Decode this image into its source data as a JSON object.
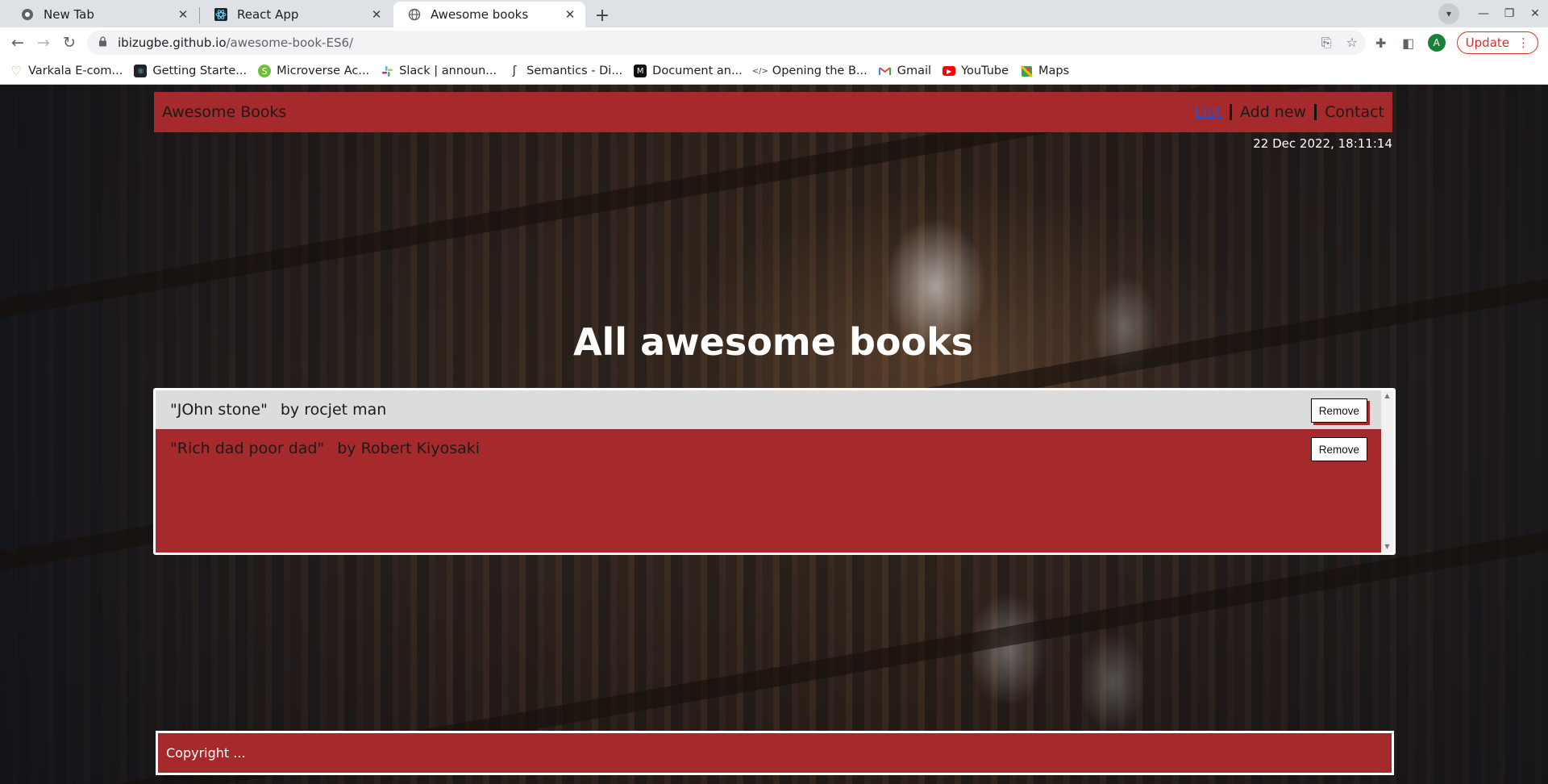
{
  "browser": {
    "tabs": [
      {
        "title": "New Tab",
        "icon": "chrome-icon"
      },
      {
        "title": "React App",
        "icon": "react-icon"
      },
      {
        "title": "Awesome books",
        "icon": "globe-icon",
        "active": true
      }
    ],
    "url_host": "ibizugbe.github.io",
    "url_path": "/awesome-book-ES6/",
    "update_label": "Update",
    "avatar_letter": "A",
    "bookmarks": [
      {
        "label": "Varkala E-com...",
        "icon": "heart-icon"
      },
      {
        "label": "Getting Starte...",
        "icon": "react-icon"
      },
      {
        "label": "Microverse Ac...",
        "icon": "microverse-icon"
      },
      {
        "label": "Slack | announ...",
        "icon": "slack-icon"
      },
      {
        "label": "Semantics - Di...",
        "icon": "semantics-icon"
      },
      {
        "label": "Document an...",
        "icon": "medium-icon"
      },
      {
        "label": "Opening the B...",
        "icon": "code-icon"
      },
      {
        "label": "Gmail",
        "icon": "gmail-icon"
      },
      {
        "label": "YouTube",
        "icon": "youtube-icon"
      },
      {
        "label": "Maps",
        "icon": "maps-icon"
      }
    ]
  },
  "site": {
    "brand": "Awesome Books",
    "nav": {
      "list": "List",
      "add_new": "Add new",
      "contact": "Contact"
    },
    "datetime": "22 Dec 2022, 18:11:14",
    "heading": "All awesome books",
    "books": [
      {
        "title": "\"JOhn stone\"",
        "author": "by rocjet man",
        "remove_label": "Remove"
      },
      {
        "title": "\"Rich dad poor dad\"",
        "author": "by Robert Kiyosaki",
        "remove_label": "Remove"
      }
    ],
    "footer": "Copyright ..."
  },
  "colors": {
    "accent_red": "#a62a2b",
    "row_light": "#dcdcdc",
    "nav_active": "#3b4db8"
  }
}
